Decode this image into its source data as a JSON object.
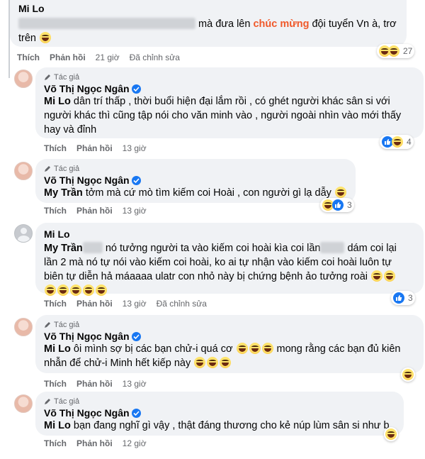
{
  "comments": [
    {
      "name": "Mi Lo",
      "text_a": "mà đưa lên",
      "highlight": "chúc mừng",
      "text_b": "đội tuyển Vn à, trơ",
      "text_c": "trên",
      "actions": {
        "like": "Thích",
        "reply": "Phản hồi",
        "time": "21 giờ",
        "edited": "Đã chỉnh sửa"
      },
      "reaction_count": "27"
    },
    {
      "badge": "Tác giả",
      "name": "Võ Thị Ngọc Ngân",
      "mention": "Mi Lo",
      "line1": "dân trí thấp , thời buổi hiện đại lắm rồi , có ghét người khác sân si với",
      "line2": "người khác thì cũng tập nói cho văn minh vào , người ngoài nhìn vào mới thấy",
      "line3": "hay và đỉnh",
      "actions": {
        "like": "Thích",
        "reply": "Phản hồi",
        "time": "13 giờ"
      },
      "reaction_count": "4"
    },
    {
      "badge": "Tác giả",
      "name": "Võ Thị Ngọc Ngân",
      "mention": "My Trần",
      "line1": "tởm mà cứ mò tìm kiếm coi Hoài , con người gì lạ dẫy",
      "actions": {
        "like": "Thích",
        "reply": "Phản hồi",
        "time": "13 giờ"
      },
      "reaction_count": "3"
    },
    {
      "name": "Mi Lo",
      "mention": "My Trần",
      "line1a": "nó tưởng người ta vào kiếm coi hoài kìa coi lần",
      "line1b": "dám coi lại",
      "line2": "lần 2 mà nó tự nói vào kiếm coi hoài, ko ai tự nhận vào kiếm coi hoài luôn tự",
      "line3": "biên tự diễn hả máaaaa ulatr con nhỏ này bị chứng bệnh ảo tưởng roài",
      "actions": {
        "like": "Thích",
        "reply": "Phản hồi",
        "time": "13 giờ",
        "edited": "Đã chỉnh sửa"
      },
      "reaction_count": "3"
    },
    {
      "badge": "Tác giả",
      "name": "Võ Thị Ngọc Ngân",
      "mention": "Mi Lo",
      "line1a": "ôi mình sợ bị các bạn chử-i quá cơ",
      "line1b": "mong rằng các bạn đủ kiên",
      "line2": "nhẫn để chử-i Minh hết kiếp này",
      "actions": {
        "like": "Thích",
        "reply": "Phản hồi",
        "time": "13 giờ"
      }
    },
    {
      "badge": "Tác giả",
      "name": "Võ Thị Ngọc Ngân",
      "mention": "Mi Lo",
      "line1": "bạn đang nghĩ gì vậy , thật đáng thương cho kẻ núp lùm sân si như b",
      "actions": {
        "like": "Thích",
        "reply": "Phản hồi",
        "time": "12 giờ"
      }
    }
  ],
  "colors": {
    "bubble": "#f0f2f5",
    "highlight": "#f0592a",
    "meta": "#65676b",
    "like": "#1877f2"
  }
}
